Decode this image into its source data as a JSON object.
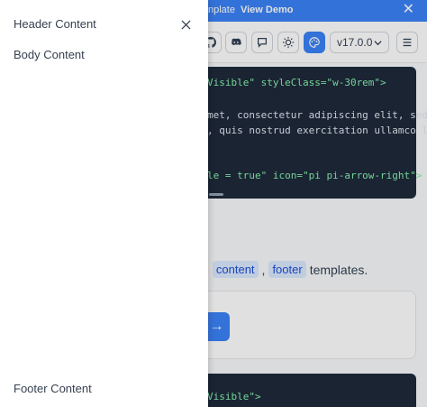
{
  "sidebar": {
    "header": "Header Content",
    "body": "Body Content",
    "footer": "Footer Content"
  },
  "topbar": {
    "text": "nplate",
    "link": "View Demo"
  },
  "toolbar": {
    "version": "v17.0.0"
  },
  "code_block_1": {
    "lines": [
      "Visible\" styleClass=\"w-30rem\">",
      "",
      "met, consectetur adipiscing elit, sed",
      ", quis nostrud exercitation ullamco l",
      "",
      "",
      "le = true\" icon=\"pi pi-arrow-right\">"
    ]
  },
  "paragraph": {
    "prefix": ",",
    "chip_content": "content",
    "sep": ",",
    "chip_footer": "footer",
    "suffix": "templates."
  },
  "code_block_2": {
    "line": "Visible\">"
  },
  "colors": {
    "accent": "#3b82f6",
    "code_bg": "#1e293b",
    "code_string": "#86efac"
  }
}
